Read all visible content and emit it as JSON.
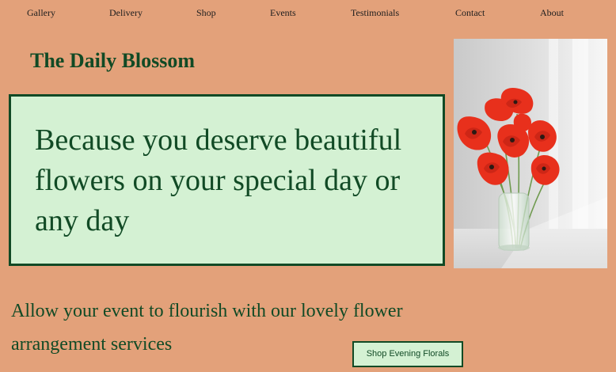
{
  "nav": {
    "items": [
      "Gallery",
      "Delivery",
      "Shop",
      "Events",
      "Testimonials",
      "Contact",
      "About"
    ]
  },
  "brand": {
    "title": "The Daily Blossom"
  },
  "hero": {
    "headline": "Because you deserve beautiful flowers on your special day or any day",
    "image_name": "red-poppies-in-glass-vase-photo"
  },
  "services": {
    "tagline": "Allow your event to flourish with our lovely flower arrangement services",
    "cta_label": "Shop Evening Florals"
  },
  "colors": {
    "page_background": "#e3a17a",
    "brand_green": "#114a25",
    "panel_mint": "#d4f1d3",
    "flower_red": "#e8301c"
  }
}
